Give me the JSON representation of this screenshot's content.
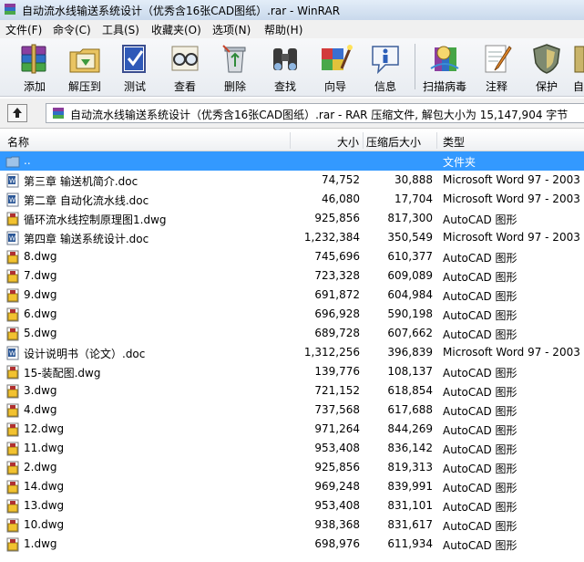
{
  "window": {
    "title": "自动流水线输送系统设计（优秀含16张CAD图纸）.rar - WinRAR"
  },
  "menu": [
    "文件(F)",
    "命令(C)",
    "工具(S)",
    "收藏夹(O)",
    "选项(N)",
    "帮助(H)"
  ],
  "toolbar": [
    {
      "label": "添加",
      "icon": "books-add-icon"
    },
    {
      "label": "解压到",
      "icon": "extract-folder-icon"
    },
    {
      "label": "测试",
      "icon": "test-check-icon"
    },
    {
      "label": "查看",
      "icon": "view-glasses-icon"
    },
    {
      "label": "删除",
      "icon": "delete-recycle-icon"
    },
    {
      "label": "查找",
      "icon": "find-binoculars-icon"
    },
    {
      "label": "向导",
      "icon": "wizard-icon"
    },
    {
      "label": "信息",
      "icon": "info-icon"
    },
    {
      "label": "扫描病毒",
      "icon": "virus-scan-icon"
    },
    {
      "label": "注释",
      "icon": "comment-icon"
    },
    {
      "label": "保护",
      "icon": "protect-shield-icon"
    },
    {
      "label": "自",
      "icon": "sfx-icon"
    }
  ],
  "address": {
    "text": "自动流水线输送系统设计（优秀含16张CAD图纸）.rar - RAR 压缩文件, 解包大小为 15,147,904 字节"
  },
  "columns": {
    "name": "名称",
    "size": "大小",
    "packed": "压缩后大小",
    "type": "类型"
  },
  "colors": {
    "selection": "#3399ff",
    "word_icon": "#2b5797",
    "dwg_icon": "#f2c230"
  },
  "files": [
    {
      "name": "..",
      "size": "",
      "packed": "",
      "type": "文件夹",
      "kind": "folder",
      "selected": true
    },
    {
      "name": "第三章 输送机简介.doc",
      "size": "74,752",
      "packed": "30,888",
      "type": "Microsoft Word 97 - 2003",
      "kind": "doc"
    },
    {
      "name": "第二章 自动化流水线.doc",
      "size": "46,080",
      "packed": "17,704",
      "type": "Microsoft Word 97 - 2003",
      "kind": "doc"
    },
    {
      "name": "循环流水线控制原理图1.dwg",
      "size": "925,856",
      "packed": "817,300",
      "type": "AutoCAD 图形",
      "kind": "dwg"
    },
    {
      "name": "第四章 输送系统设计.doc",
      "size": "1,232,384",
      "packed": "350,549",
      "type": "Microsoft Word 97 - 2003",
      "kind": "doc"
    },
    {
      "name": "8.dwg",
      "size": "745,696",
      "packed": "610,377",
      "type": "AutoCAD 图形",
      "kind": "dwg"
    },
    {
      "name": "7.dwg",
      "size": "723,328",
      "packed": "609,089",
      "type": "AutoCAD 图形",
      "kind": "dwg"
    },
    {
      "name": "9.dwg",
      "size": "691,872",
      "packed": "604,984",
      "type": "AutoCAD 图形",
      "kind": "dwg"
    },
    {
      "name": "6.dwg",
      "size": "696,928",
      "packed": "590,198",
      "type": "AutoCAD 图形",
      "kind": "dwg"
    },
    {
      "name": "5.dwg",
      "size": "689,728",
      "packed": "607,662",
      "type": "AutoCAD 图形",
      "kind": "dwg"
    },
    {
      "name": "设计说明书（论文）.doc",
      "size": "1,312,256",
      "packed": "396,839",
      "type": "Microsoft Word 97 - 2003",
      "kind": "doc"
    },
    {
      "name": "15-装配图.dwg",
      "size": "139,776",
      "packed": "108,137",
      "type": "AutoCAD 图形",
      "kind": "dwg"
    },
    {
      "name": "3.dwg",
      "size": "721,152",
      "packed": "618,854",
      "type": "AutoCAD 图形",
      "kind": "dwg"
    },
    {
      "name": "4.dwg",
      "size": "737,568",
      "packed": "617,688",
      "type": "AutoCAD 图形",
      "kind": "dwg"
    },
    {
      "name": "12.dwg",
      "size": "971,264",
      "packed": "844,269",
      "type": "AutoCAD 图形",
      "kind": "dwg"
    },
    {
      "name": "11.dwg",
      "size": "953,408",
      "packed": "836,142",
      "type": "AutoCAD 图形",
      "kind": "dwg"
    },
    {
      "name": "2.dwg",
      "size": "925,856",
      "packed": "819,313",
      "type": "AutoCAD 图形",
      "kind": "dwg"
    },
    {
      "name": "14.dwg",
      "size": "969,248",
      "packed": "839,991",
      "type": "AutoCAD 图形",
      "kind": "dwg"
    },
    {
      "name": "13.dwg",
      "size": "953,408",
      "packed": "831,101",
      "type": "AutoCAD 图形",
      "kind": "dwg"
    },
    {
      "name": "10.dwg",
      "size": "938,368",
      "packed": "831,617",
      "type": "AutoCAD 图形",
      "kind": "dwg"
    },
    {
      "name": "1.dwg",
      "size": "698,976",
      "packed": "611,934",
      "type": "AutoCAD 图形",
      "kind": "dwg"
    }
  ]
}
